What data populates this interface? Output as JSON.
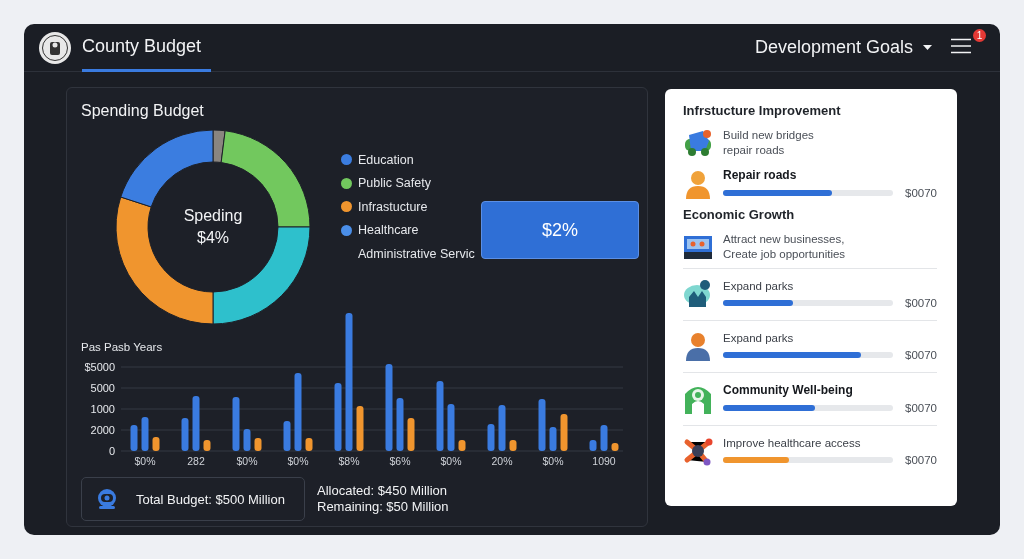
{
  "header": {
    "tab": {
      "label": "County Budget",
      "selected": true
    },
    "dropdown": "Development Goals",
    "badge": "1"
  },
  "spending": {
    "title": "Spending Budget",
    "center": [
      "Speding",
      "$4%"
    ],
    "legend": [
      {
        "label": "Education",
        "color": "#3b7de0"
      },
      {
        "label": "Public Safety",
        "color": "#72c85e"
      },
      {
        "label": "Infrastucture",
        "color": "#f0952e"
      },
      {
        "label": "Healthcare",
        "color": "#4a8ee8"
      },
      {
        "label": "Administrative Servic"
      }
    ],
    "highlight": "$2%",
    "history": {
      "title": "Pas Pasb Years",
      "y_labels": [
        "$5000",
        "5000",
        "1000",
        "2000",
        "0"
      ],
      "x_labels": [
        "$0%",
        "282",
        "$0%",
        "$0%",
        "$8%",
        "$6%",
        "$0%",
        "20%",
        "$0%",
        "1090"
      ]
    },
    "total": "Total Budget: $500 Million",
    "allocated": "Allocated: $450 Million",
    "remaining": "Remaining: $50 Million"
  },
  "goals": [
    {
      "kind": "heading",
      "text": "Infrstucture Improvement"
    },
    {
      "kind": "text",
      "lines": [
        "Build new bridges",
        "repair roads"
      ],
      "divider": false
    },
    {
      "kind": "progress",
      "label": "Repair roads",
      "bold": true,
      "level": 0.64,
      "amount": "$0070",
      "color": "#2f6fd6",
      "divider": false
    },
    {
      "kind": "heading",
      "text": "Economic Growth"
    },
    {
      "kind": "text",
      "lines": [
        "Attract new businesses,",
        "Create job opportunities"
      ],
      "divider": false
    },
    {
      "kind": "progress",
      "label": "Expand parks",
      "bold": false,
      "level": 0.41,
      "amount": "$0070",
      "color": "#2f6fd6",
      "divider": true
    },
    {
      "kind": "progress",
      "label": "Expand parks",
      "bold": false,
      "level": 0.81,
      "amount": "$0070",
      "color": "#2f6fd6",
      "divider": true
    },
    {
      "kind": "progress",
      "label": "Community Well-being",
      "bold": true,
      "level": 0.54,
      "amount": "$0070",
      "color": "#2f6fd6",
      "divider": true
    },
    {
      "kind": "progress",
      "label": "Improve healthcare access",
      "bold": false,
      "level": 0.39,
      "amount": "$0070",
      "color": "#f0952e",
      "divider": true
    }
  ]
}
